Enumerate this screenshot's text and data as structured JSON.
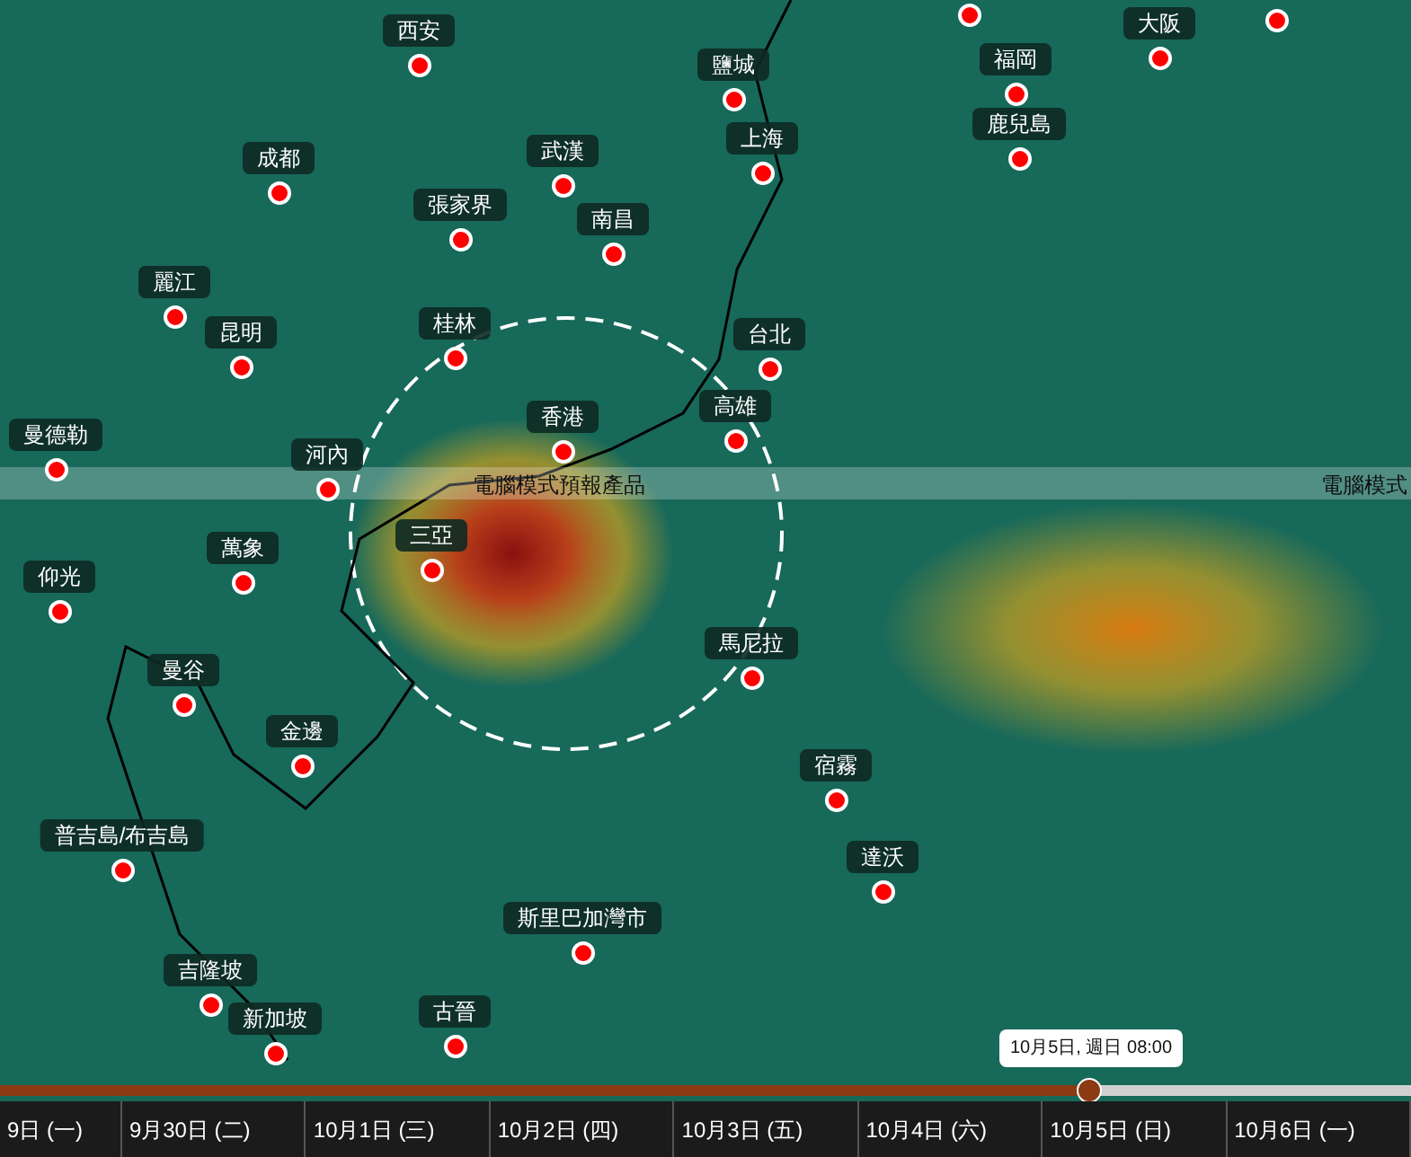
{
  "cities": [
    {
      "name": "西安"
    },
    {
      "name": "鹽城"
    },
    {
      "name": "福岡"
    },
    {
      "name": "大阪"
    },
    {
      "name": "成都"
    },
    {
      "name": "武漢"
    },
    {
      "name": "上海"
    },
    {
      "name": "鹿兒島"
    },
    {
      "name": "張家界"
    },
    {
      "name": "南昌"
    },
    {
      "name": "麗江"
    },
    {
      "name": "昆明"
    },
    {
      "name": "桂林"
    },
    {
      "name": "台北"
    },
    {
      "name": "香港"
    },
    {
      "name": "高雄"
    },
    {
      "name": "曼德勒"
    },
    {
      "name": "河內"
    },
    {
      "name": "三亞"
    },
    {
      "name": "萬象"
    },
    {
      "name": "仰光"
    },
    {
      "name": "馬尼拉"
    },
    {
      "name": "曼谷"
    },
    {
      "name": "金邊"
    },
    {
      "name": "宿霧"
    },
    {
      "name": "普吉島/布吉島"
    },
    {
      "name": "達沃"
    },
    {
      "name": "斯里巴加灣市"
    },
    {
      "name": "吉隆坡"
    },
    {
      "name": "古晉"
    },
    {
      "name": "新加坡"
    }
  ],
  "banner": [
    "電腦模式預報產品",
    "電腦模式"
  ],
  "timeline": {
    "level": 0.772,
    "tooltip": "10月5日, 週日 08:00",
    "days": [
      "9日 (一)",
      "9月30日 (二)",
      "10月1日 (三)",
      "10月2日 (四)",
      "10月3日 (五)",
      "10月4日 (六)",
      "10月5日 (日)",
      "10月6日 (一)"
    ]
  }
}
